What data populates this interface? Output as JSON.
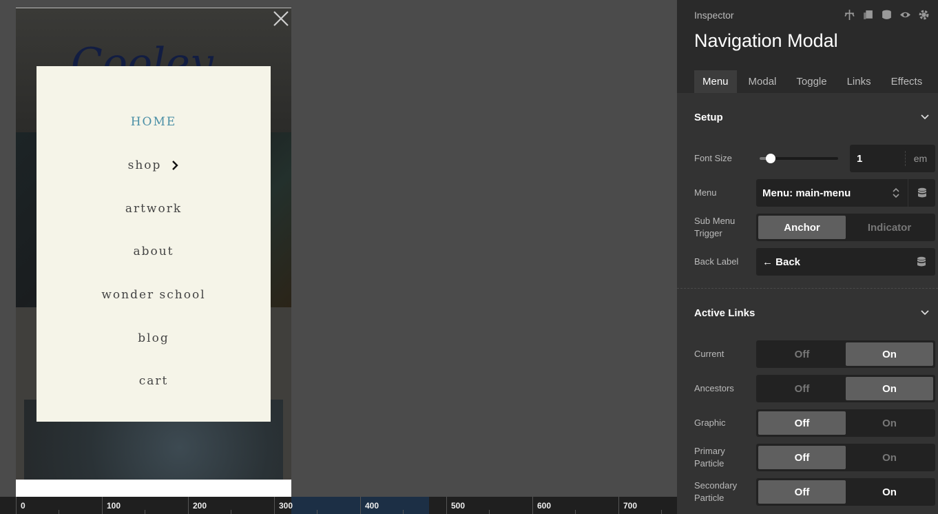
{
  "preview": {
    "logo_text": "Cooley",
    "menu": [
      {
        "label": "HOME",
        "active": true
      },
      {
        "label": "shop",
        "submenu": true
      },
      {
        "label": "artwork"
      },
      {
        "label": "about"
      },
      {
        "label": "wonder school"
      },
      {
        "label": "blog"
      },
      {
        "label": "cart"
      }
    ]
  },
  "ruler": {
    "labels": [
      "0",
      "100",
      "200",
      "300",
      "400",
      "500",
      "600",
      "700"
    ]
  },
  "inspector": {
    "label": "Inspector",
    "title": "Navigation Modal",
    "header_icons": [
      "pin-icon",
      "copy-icon",
      "database-icon",
      "eye-icon",
      "gear-icon"
    ],
    "tabs": [
      {
        "label": "Menu",
        "active": true
      },
      {
        "label": "Modal"
      },
      {
        "label": "Toggle"
      },
      {
        "label": "Links"
      },
      {
        "label": "Effects"
      }
    ],
    "setup": {
      "heading": "Setup",
      "font_size": {
        "label": "Font Size",
        "value": "1",
        "unit": "em",
        "slider_fraction": 0.14
      },
      "menu": {
        "label": "Menu",
        "value": "Menu: main-menu"
      },
      "sub_menu_trigger": {
        "label": "Sub Menu Trigger",
        "options": [
          "Anchor",
          "Indicator"
        ],
        "selected": "Anchor"
      },
      "back_label": {
        "label": "Back Label",
        "value": "← Back"
      }
    },
    "active_links": {
      "heading": "Active Links",
      "rows": [
        {
          "name": "current",
          "label": "Current",
          "off": "Off",
          "on": "On",
          "selected": "On"
        },
        {
          "name": "ancestors",
          "label": "Ancestors",
          "off": "Off",
          "on": "On",
          "selected": "On"
        },
        {
          "name": "graphic",
          "label": "Graphic",
          "off": "Off",
          "on": "On",
          "selected": "Off"
        },
        {
          "name": "primary-particle",
          "label": "Primary Particle",
          "off": "Off",
          "on": "On",
          "selected": "Off"
        },
        {
          "name": "secondary-particle",
          "label": "Secondary Particle",
          "off": "Off",
          "on": "On",
          "selected": "Off",
          "on_bright": true
        }
      ]
    },
    "colors": {
      "accent_link": "#4a8fa6",
      "modal_bg": "#f5f4e8",
      "panel_bg": "#333333",
      "segment_on": "#5f5f5f"
    }
  }
}
